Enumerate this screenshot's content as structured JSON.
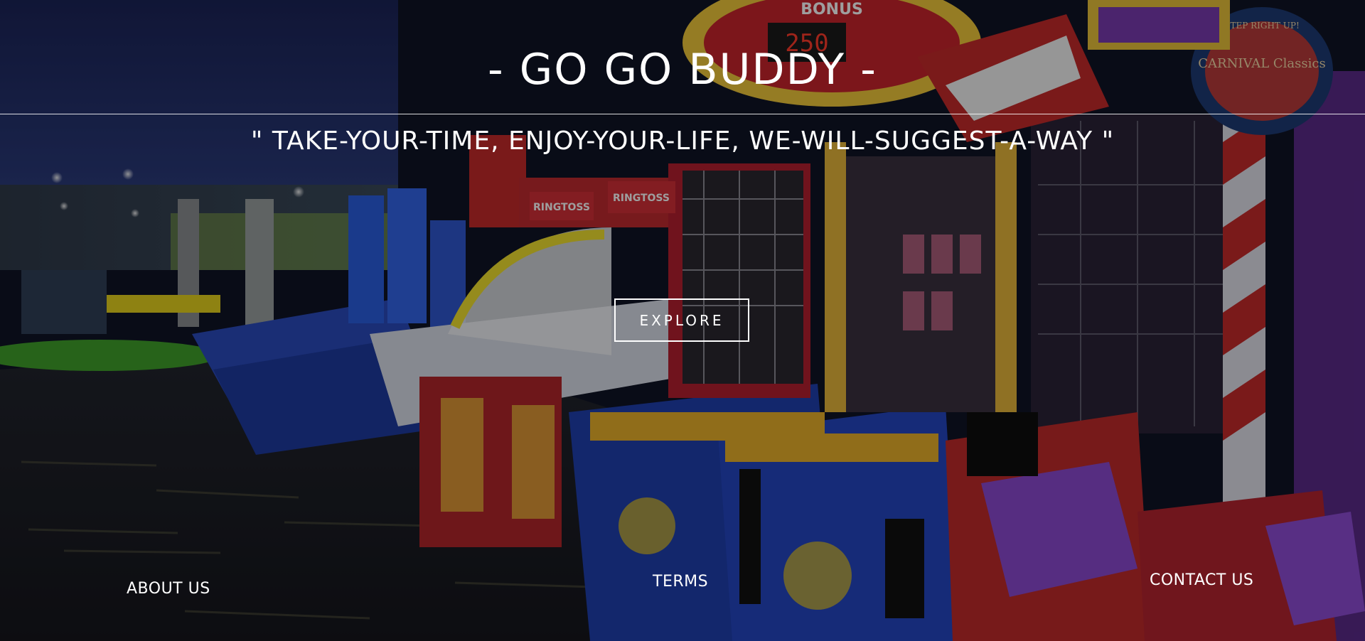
{
  "hero": {
    "title": "- GO GO BUDDY -",
    "tagline": "\" TAKE-YOUR-TIME, ENJOY-YOUR-LIFE, WE-WILL-SUGGEST-A-WAY \"",
    "explore_label": "EXPLORE",
    "background_image": "arcade-carnival-games-photo",
    "signs": {
      "bonus_sign": "BONUS",
      "bonus_value": "250",
      "ring_toss_1": "RINGTOSS",
      "ring_toss_2": "RINGTOSS",
      "carnival_logo": "CARNIVAL Classics",
      "carnival_top": "STEP RIGHT UP!"
    }
  },
  "footer": {
    "about_label": "ABOUT US",
    "terms_label": "TERMS",
    "contact_label": "CONTACT US"
  },
  "colors": {
    "text": "#ffffff",
    "overlay": "#000000"
  }
}
